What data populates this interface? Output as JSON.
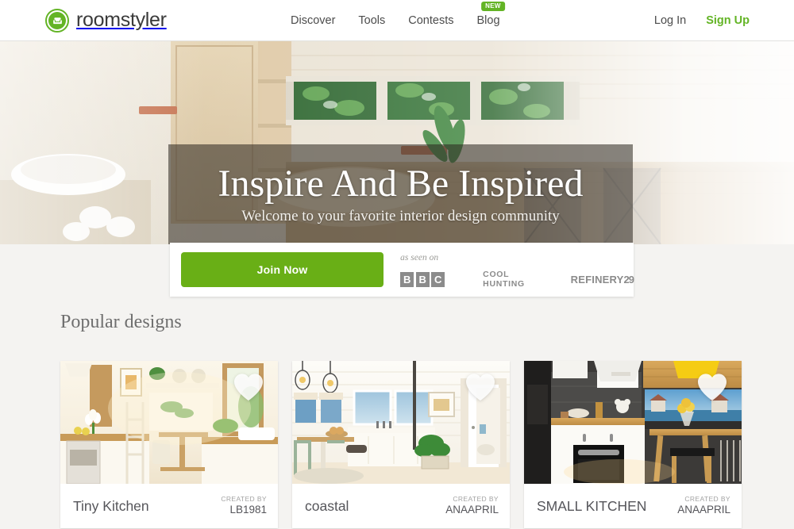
{
  "brand": {
    "name": "roomstyler",
    "logo_icon": "armchair-icon",
    "accent_color": "#63b425"
  },
  "header": {
    "nav": [
      {
        "label": "Discover",
        "badge": ""
      },
      {
        "label": "Tools",
        "badge": ""
      },
      {
        "label": "Contests",
        "badge": ""
      },
      {
        "label": "Blog",
        "badge": "NEW"
      }
    ],
    "login_label": "Log In",
    "signup_label": "Sign Up"
  },
  "hero": {
    "title": "Inspire And Be Inspired",
    "subtitle": "Welcome to your favorite interior design community",
    "image_alt": "bright-kitchen-interior-render"
  },
  "cta": {
    "join_label": "Join Now",
    "as_seen_on_label": "as seen on",
    "press": [
      {
        "name": "BBC",
        "letters": [
          "B",
          "B",
          "C"
        ]
      },
      {
        "name": "COOL HUNTING"
      },
      {
        "name": "REFINERY29",
        "word": "REFINERY",
        "number": "29"
      }
    ]
  },
  "popular": {
    "heading": "Popular designs",
    "credit_label": "CREATED BY",
    "cards": [
      {
        "title": "Tiny Kitchen",
        "author": "LB1981",
        "favorite_icon": "heart-icon",
        "image_alt": "cream-kitchen-with-tulips"
      },
      {
        "title": "coastal",
        "author": "ANAAPRIL",
        "favorite_icon": "heart-icon",
        "image_alt": "white-coastal-dining-kitchen"
      },
      {
        "title": "SMALL KITCHEN",
        "author": "ANAAPRIL",
        "favorite_icon": "heart-icon",
        "image_alt": "dark-slate-kitchen-with-sea-view"
      }
    ]
  }
}
